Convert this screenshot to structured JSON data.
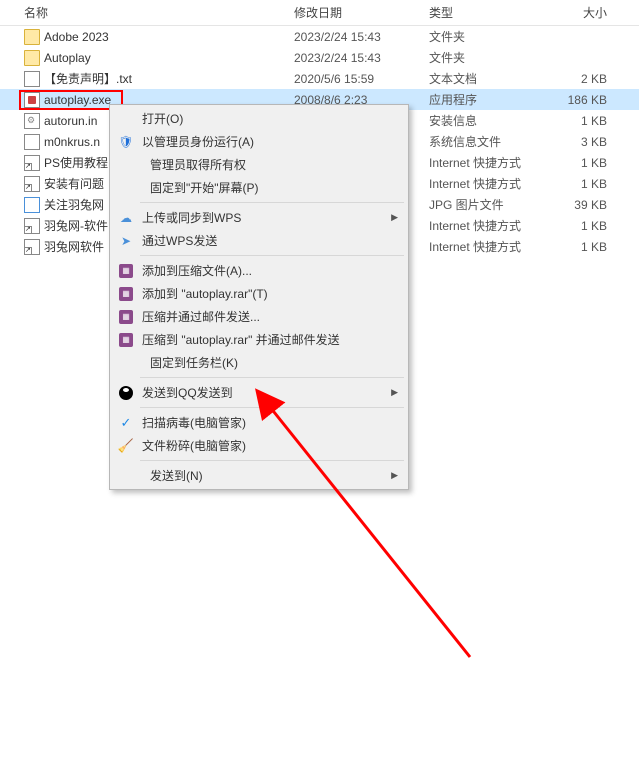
{
  "header": {
    "name": "名称",
    "date": "修改日期",
    "type": "类型",
    "size": "大小"
  },
  "files": [
    {
      "icon": "folder",
      "name": "Adobe 2023",
      "date": "2023/2/24 15:43",
      "type": "文件夹",
      "size": ""
    },
    {
      "icon": "folder",
      "name": "Autoplay",
      "date": "2023/2/24 15:43",
      "type": "文件夹",
      "size": ""
    },
    {
      "icon": "txt",
      "name": "【免责声明】.txt",
      "date": "2020/5/6 15:59",
      "type": "文本文档",
      "size": "2 KB"
    },
    {
      "icon": "exe",
      "name": "autoplay.exe",
      "date": "2008/8/6 2:23",
      "type": "应用程序",
      "size": "186 KB",
      "selected": true
    },
    {
      "icon": "ini",
      "name": "autorun.in",
      "date": "",
      "type": "安装信息",
      "size": "1 KB"
    },
    {
      "icon": "sys",
      "name": "m0nkrus.n",
      "date": "",
      "type": "系统信息文件",
      "size": "3 KB"
    },
    {
      "icon": "link",
      "name": "PS使用教程",
      "date": "",
      "type": "Internet 快捷方式",
      "size": "1 KB"
    },
    {
      "icon": "link",
      "name": "安装有问题",
      "date": "",
      "type": "Internet 快捷方式",
      "size": "1 KB"
    },
    {
      "icon": "jpg",
      "name": "关注羽兔网",
      "date": "",
      "type": "JPG 图片文件",
      "size": "39 KB"
    },
    {
      "icon": "link",
      "name": "羽兔网-软件",
      "date": "",
      "type": "Internet 快捷方式",
      "size": "1 KB"
    },
    {
      "icon": "link",
      "name": "羽兔网软件",
      "date": "",
      "type": "Internet 快捷方式",
      "size": "1 KB"
    }
  ],
  "menu": {
    "open": "打开(O)",
    "run_as_admin": "以管理员身份运行(A)",
    "admin_ownership": "管理员取得所有权",
    "pin_to_start": "固定到\"开始\"屏幕(P)",
    "upload_wps": "上传或同步到WPS",
    "send_via_wps": "通过WPS发送",
    "add_to_archive": "添加到压缩文件(A)...",
    "add_to_rar": "添加到 \"autoplay.rar\"(T)",
    "compress_email": "压缩并通过邮件发送...",
    "compress_rar_email": "压缩到 \"autoplay.rar\" 并通过邮件发送",
    "pin_taskbar": "固定到任务栏(K)",
    "send_to_qq": "发送到QQ发送到",
    "scan_virus": "扫描病毒(电脑管家)",
    "shred_file": "文件粉碎(电脑管家)",
    "send_to": "发送到(N)"
  }
}
